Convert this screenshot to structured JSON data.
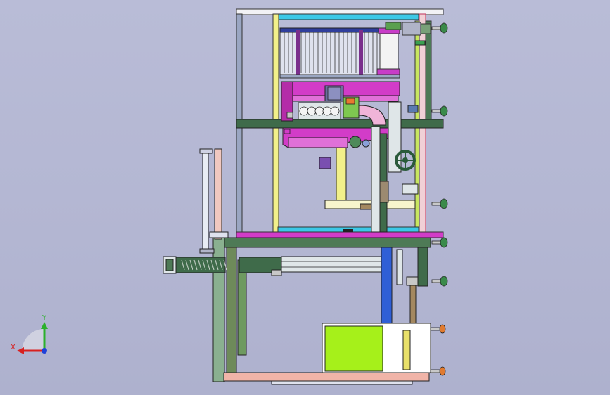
{
  "triad": {
    "x_label": "X",
    "y_label": "Y"
  },
  "colors": {
    "background": "#b6b9d4",
    "frame_white": "#f2f2f5",
    "frame_steel": "#8f9bb8",
    "dark_green": "#3f6b4a",
    "olive_green": "#6e8a5a",
    "yellow": "#f2f08a",
    "magenta": "#d23cc8",
    "cyan": "#3cc8e6",
    "blue": "#2f5fd6",
    "lime": "#a6f01a",
    "salmon": "#f0b4a8",
    "purple": "#7a4fb0"
  }
}
